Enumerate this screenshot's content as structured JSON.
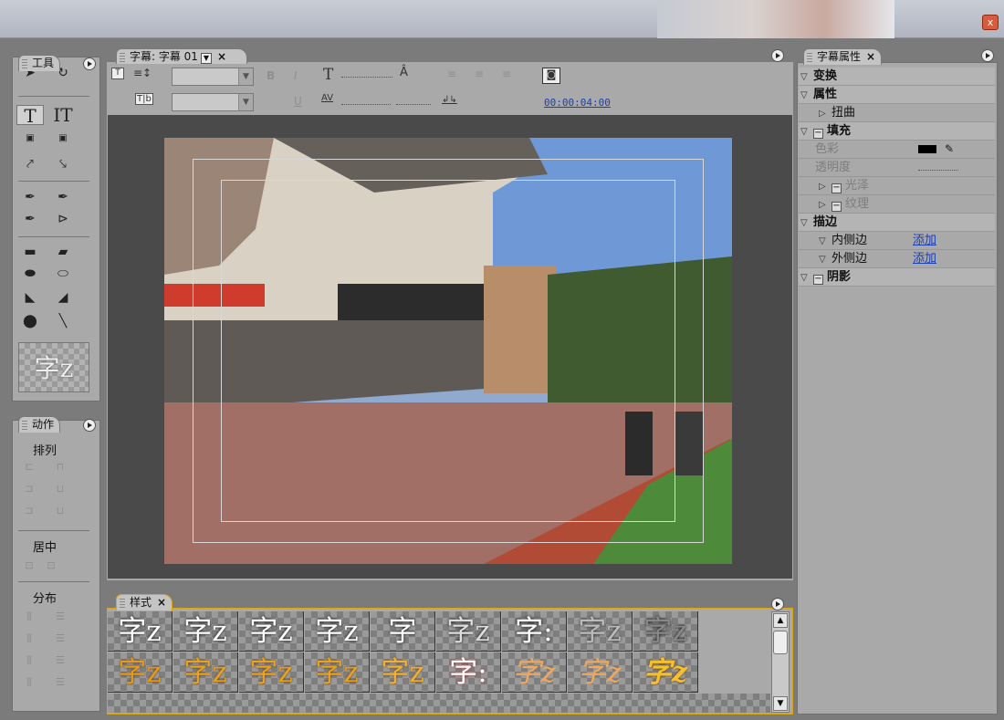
{
  "window": {
    "close_label": "x"
  },
  "tools_panel": {
    "tab_label": "工具",
    "tools": [
      "T",
      "IT"
    ],
    "style_preview": "字z"
  },
  "actions_panel": {
    "tab_label": "动作",
    "sections": [
      "排列",
      "居中",
      "分布"
    ]
  },
  "editor": {
    "tab_label": "字幕: 字幕 01",
    "timecode": "00:00:04:00"
  },
  "styles_panel": {
    "tab_label": "样式",
    "row1": [
      "字z",
      "字z",
      "字z",
      "字z",
      "字",
      "字z",
      "字:",
      "字z",
      "字z"
    ],
    "row2": [
      "字z",
      "字z",
      "字z",
      "字z",
      "字z",
      "字:",
      "字z",
      "字z",
      "字z"
    ]
  },
  "properties": {
    "tab_label": "字幕属性",
    "rows": [
      {
        "label": "变换",
        "bold": true
      },
      {
        "label": "属性",
        "bold": true
      },
      {
        "label": "扭曲"
      },
      {
        "label": "填充",
        "bold": true
      },
      {
        "label": "色彩"
      },
      {
        "label": "透明度"
      },
      {
        "label": "光泽"
      },
      {
        "label": "纹理"
      },
      {
        "label": "描边",
        "bold": true
      },
      {
        "label": "内侧边",
        "value": "添加"
      },
      {
        "label": "外侧边",
        "value": "添加"
      },
      {
        "label": "阴影",
        "bold": true
      }
    ],
    "fill_color": "#000000"
  },
  "colors": {
    "accent": "#d9a514",
    "link": "#1a3fb5"
  }
}
